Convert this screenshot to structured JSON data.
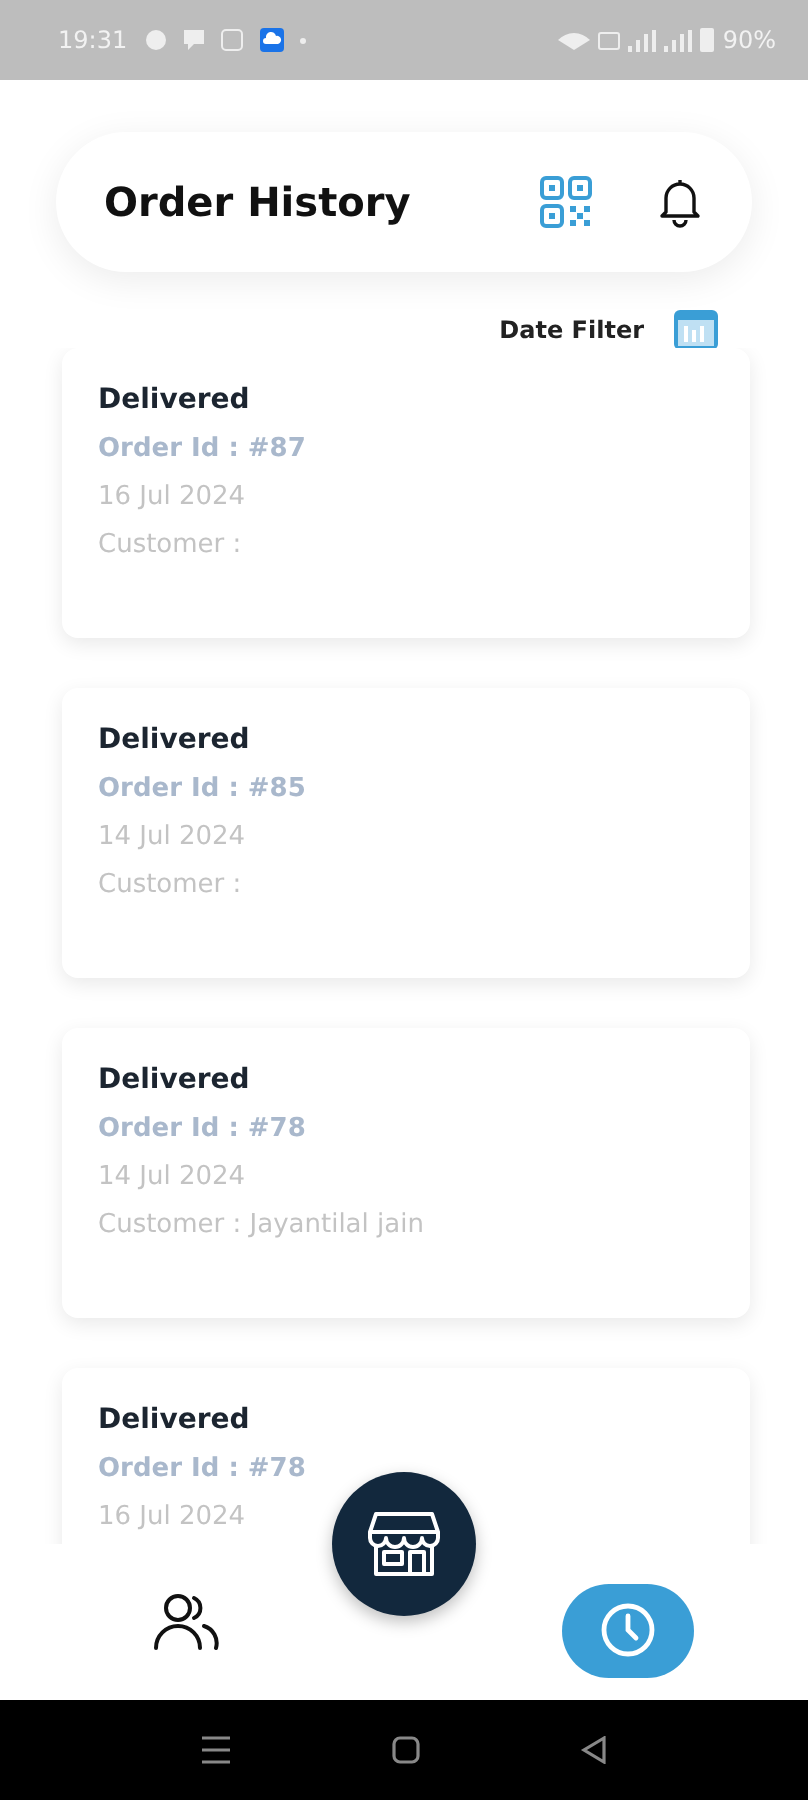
{
  "status_bar": {
    "time": "19:31",
    "battery": "90%"
  },
  "header": {
    "title": "Order History"
  },
  "filter": {
    "label": "Date Filter"
  },
  "orders": [
    {
      "status": "Delivered",
      "order_id": "Order Id : #87",
      "date": "16 Jul 2024",
      "customer": "Customer :"
    },
    {
      "status": "Delivered",
      "order_id": "Order Id : #85",
      "date": "14 Jul 2024",
      "customer": "Customer :"
    },
    {
      "status": "Delivered",
      "order_id": "Order Id : #78",
      "date": "14 Jul 2024",
      "customer": "Customer : Jayantilal jain"
    },
    {
      "status": "Delivered",
      "order_id": "Order Id : #78",
      "date": "16 Jul 2024"
    }
  ],
  "bottom_nav": [
    {
      "kind": "people",
      "selected": false
    },
    {
      "kind": "store",
      "selected": false
    },
    {
      "kind": "history",
      "selected": true
    }
  ]
}
